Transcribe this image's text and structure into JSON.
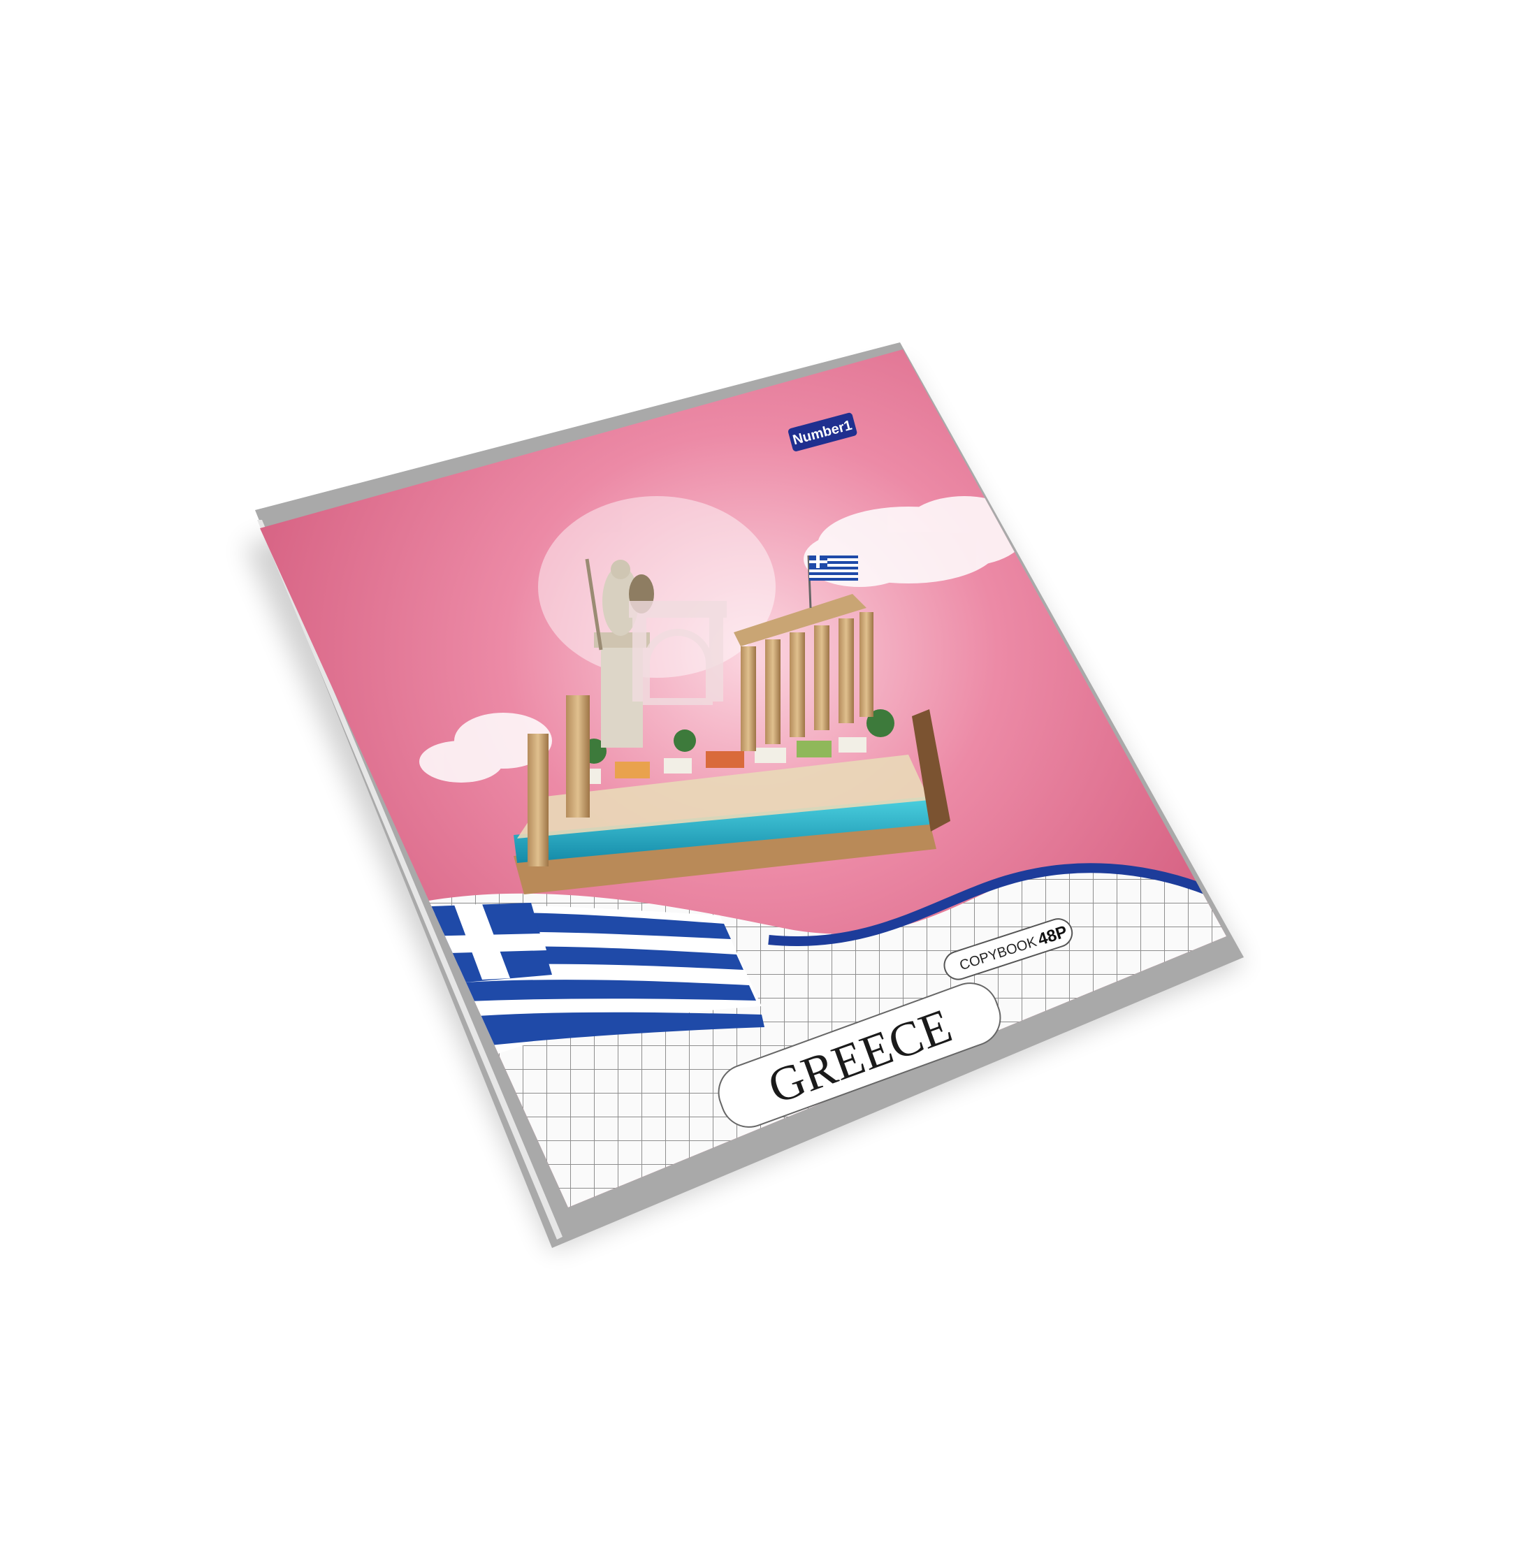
{
  "product": {
    "brand_logo": "Number1",
    "label_type": "COPYBOOK",
    "page_count": "48P",
    "title": "GREECE"
  },
  "colors": {
    "cover_pink": "#cf4f73",
    "cover_pink_light": "#f3aabd",
    "grey_band": "#a6a6a6",
    "flag_blue": "#1f4aa8",
    "wave_blue": "#1d3c9a",
    "grid_line": "#8a8a8a",
    "sea": "#2bb3c9",
    "logo_bg": "#1f2f8f"
  },
  "icons": [
    "greek-flag-icon",
    "small-greek-flag-icon",
    "athena-statue-icon",
    "temple-columns-icon",
    "arch-icon"
  ]
}
